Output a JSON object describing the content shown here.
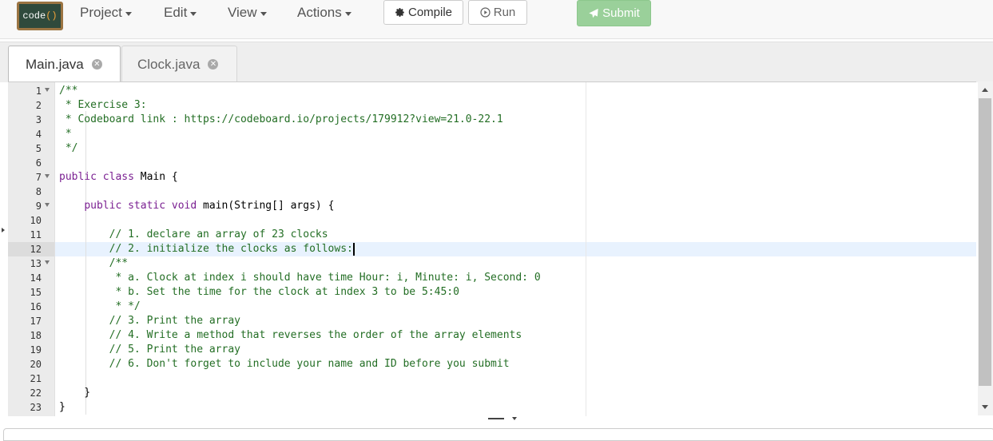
{
  "logo": {
    "text": "code",
    "paren": "()"
  },
  "menu": {
    "project": "Project",
    "edit": "Edit",
    "view": "View",
    "actions": "Actions"
  },
  "toolbar": {
    "compile_label": "Compile",
    "run_label": "Run",
    "submit_label": "Submit"
  },
  "tabs": [
    {
      "label": "Main.java",
      "active": true
    },
    {
      "label": "Clock.java",
      "active": false
    }
  ],
  "editor": {
    "active_line": 12,
    "lines": [
      {
        "n": "1",
        "fold": true,
        "parts": [
          [
            "cmt",
            "/**"
          ]
        ]
      },
      {
        "n": "2",
        "parts": [
          [
            "cmt",
            " * Exercise 3:"
          ]
        ]
      },
      {
        "n": "3",
        "parts": [
          [
            "cmt",
            " * Codeboard link : https://codeboard.io/projects/179912?view=21.0-22.1"
          ]
        ]
      },
      {
        "n": "4",
        "parts": [
          [
            "cmt",
            " *"
          ]
        ]
      },
      {
        "n": "5",
        "parts": [
          [
            "cmt",
            " */"
          ]
        ]
      },
      {
        "n": "6",
        "parts": []
      },
      {
        "n": "7",
        "fold": true,
        "parts": [
          [
            "kw",
            "public class "
          ],
          [
            "plain",
            "Main {"
          ]
        ]
      },
      {
        "n": "8",
        "parts": []
      },
      {
        "n": "9",
        "fold": true,
        "parts": [
          [
            "plain",
            "    "
          ],
          [
            "kw",
            "public static void "
          ],
          [
            "plain",
            "main(String[] args) {"
          ]
        ]
      },
      {
        "n": "10",
        "parts": []
      },
      {
        "n": "11",
        "parts": [
          [
            "plain",
            "        "
          ],
          [
            "cmt",
            "// 1. declare an array of 23 clocks"
          ]
        ]
      },
      {
        "n": "12",
        "parts": [
          [
            "plain",
            "        "
          ],
          [
            "cmt",
            "// 2. initialize the clocks as follows:"
          ]
        ]
      },
      {
        "n": "13",
        "fold": true,
        "parts": [
          [
            "plain",
            "        "
          ],
          [
            "cmt",
            "/**"
          ]
        ]
      },
      {
        "n": "14",
        "parts": [
          [
            "plain",
            "        "
          ],
          [
            "cmt",
            " * a. Clock at index i should have time Hour: i, Minute: i, Second: 0"
          ]
        ]
      },
      {
        "n": "15",
        "parts": [
          [
            "plain",
            "        "
          ],
          [
            "cmt",
            " * b. Set the time for the clock at index 3 to be 5:45:0"
          ]
        ]
      },
      {
        "n": "16",
        "parts": [
          [
            "plain",
            "        "
          ],
          [
            "cmt",
            " * */"
          ]
        ]
      },
      {
        "n": "17",
        "parts": [
          [
            "plain",
            "        "
          ],
          [
            "cmt",
            "// 3. Print the array"
          ]
        ]
      },
      {
        "n": "18",
        "parts": [
          [
            "plain",
            "        "
          ],
          [
            "cmt",
            "// 4. Write a method that reverses the order of the array elements"
          ]
        ]
      },
      {
        "n": "19",
        "parts": [
          [
            "plain",
            "        "
          ],
          [
            "cmt",
            "// 5. Print the array"
          ]
        ]
      },
      {
        "n": "20",
        "parts": [
          [
            "plain",
            "        "
          ],
          [
            "cmt",
            "// 6. Don't forget to include your name and ID before you submit"
          ]
        ]
      },
      {
        "n": "21",
        "parts": []
      },
      {
        "n": "22",
        "parts": [
          [
            "plain",
            "    }"
          ]
        ]
      },
      {
        "n": "23",
        "parts": [
          [
            "plain",
            "}"
          ]
        ]
      }
    ]
  },
  "colors": {
    "comment": "#236e24",
    "keyword": "#7a1f91",
    "submit": "#9ad09a",
    "active_line": "#e8f2fe"
  }
}
